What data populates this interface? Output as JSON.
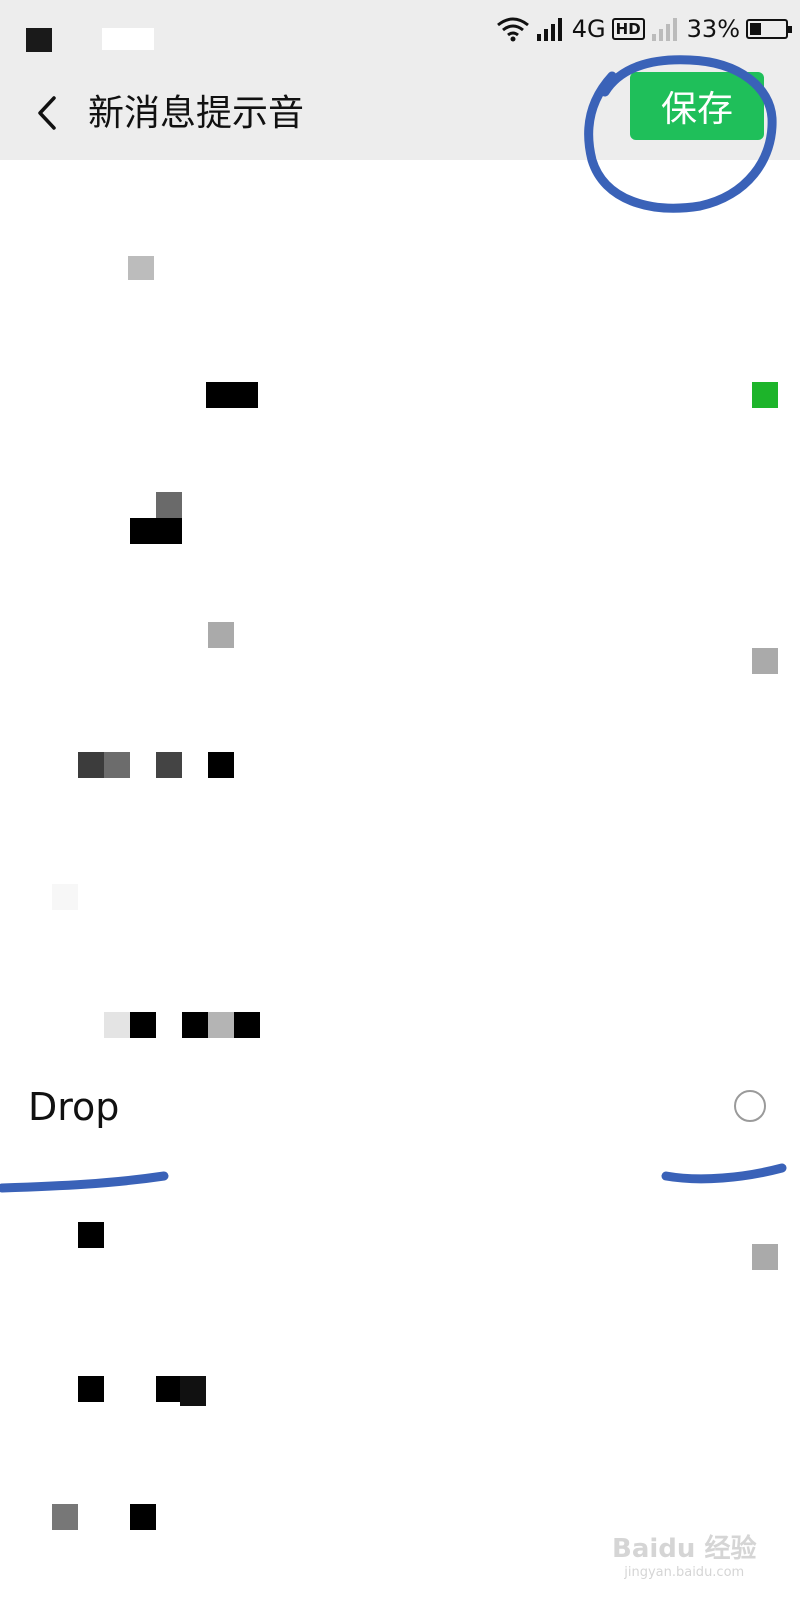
{
  "status_bar": {
    "network": "4G",
    "hd": "HD",
    "battery_text": "33%",
    "battery_level": 0.33
  },
  "header": {
    "title": "新消息提示音",
    "save_label": "保存"
  },
  "sound_list": {
    "items": [
      {
        "label": "Drop",
        "selected": false
      }
    ]
  },
  "watermark": {
    "brand": "Baidu 经验",
    "url": "jingyan.baidu.com"
  },
  "colors": {
    "accent_green": "#1fbf5a",
    "annotation_blue": "#3a62b8",
    "header_bg": "#ededed"
  }
}
